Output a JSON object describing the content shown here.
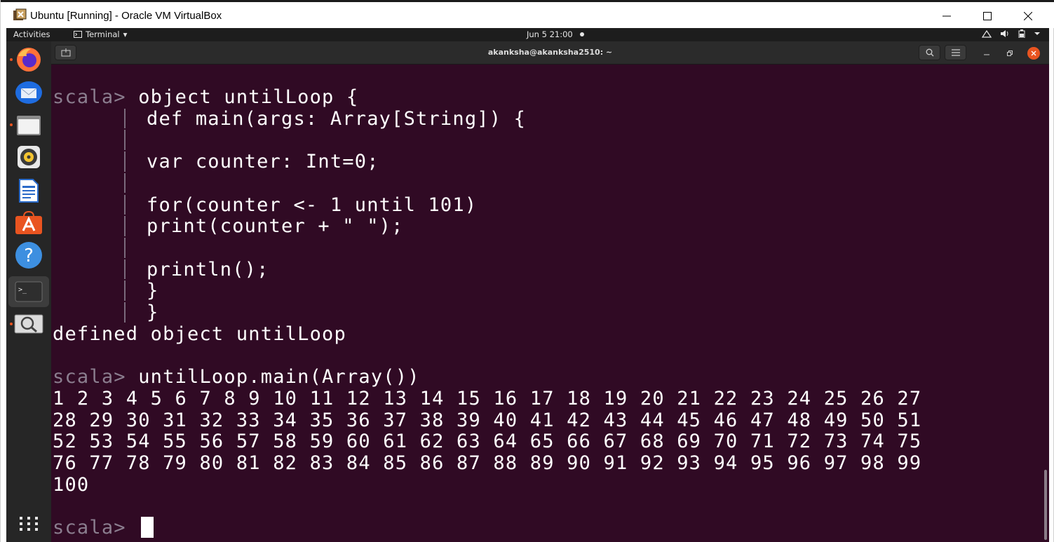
{
  "window": {
    "title": "Ubuntu [Running] - Oracle VM VirtualBox",
    "minimize_glyph": "—",
    "maximize_glyph": "☐",
    "close_glyph": "✕"
  },
  "topbar": {
    "activities": "Activities",
    "app_menu": "Terminal",
    "app_menu_arrow": "▾",
    "clock": "Jun 5  21:00"
  },
  "dock": {
    "items": [
      {
        "icon": "firefox-icon",
        "running": true
      },
      {
        "icon": "thunderbird-icon",
        "running": false
      },
      {
        "icon": "files-icon",
        "running": true
      },
      {
        "icon": "rhythmbox-icon",
        "running": false
      },
      {
        "icon": "libreoffice-writer-icon",
        "running": false
      },
      {
        "icon": "software-center-icon",
        "running": false
      },
      {
        "icon": "help-icon",
        "running": false
      },
      {
        "icon": "terminal-icon",
        "running": false,
        "active": true
      },
      {
        "icon": "screenshot-icon",
        "running": true
      }
    ],
    "help_glyph": "?",
    "terminal_glyph": ">_",
    "apps_grid_icon": "apps-grid-icon"
  },
  "terminal": {
    "title": "akanksha@akanksha2510: ~",
    "prompt": "scala> ",
    "lines": [
      {
        "prompt": true,
        "text": "object untilLoop {"
      },
      {
        "prompt": false,
        "cont": true,
        "text": "def main(args: Array[String]) {"
      },
      {
        "prompt": false,
        "cont": true,
        "text": ""
      },
      {
        "prompt": false,
        "cont": true,
        "text": "var counter: Int=0;"
      },
      {
        "prompt": false,
        "cont": true,
        "text": ""
      },
      {
        "prompt": false,
        "cont": true,
        "text": "for(counter <- 1 until 101)"
      },
      {
        "prompt": false,
        "cont": true,
        "text": "print(counter + \" \");"
      },
      {
        "prompt": false,
        "cont": true,
        "text": ""
      },
      {
        "prompt": false,
        "cont": true,
        "text": "println();"
      },
      {
        "prompt": false,
        "cont": true,
        "text": "}"
      },
      {
        "prompt": false,
        "cont": true,
        "text": "}"
      },
      {
        "prompt": false,
        "text": "defined object untilLoop"
      },
      {
        "prompt": false,
        "text": ""
      },
      {
        "prompt": true,
        "text": "untilLoop.main(Array())"
      },
      {
        "prompt": false,
        "text": "1 2 3 4 5 6 7 8 9 10 11 12 13 14 15 16 17 18 19 20 21 22 23 24 25 26 27"
      },
      {
        "prompt": false,
        "text": "28 29 30 31 32 33 34 35 36 37 38 39 40 41 42 43 44 45 46 47 48 49 50 51"
      },
      {
        "prompt": false,
        "text": "52 53 54 55 56 57 58 59 60 61 62 63 64 65 66 67 68 69 70 71 72 73 74 75"
      },
      {
        "prompt": false,
        "text": "76 77 78 79 80 81 82 83 84 85 86 87 88 89 90 91 92 93 94 95 96 97 98 99"
      },
      {
        "prompt": false,
        "text": "100"
      },
      {
        "prompt": false,
        "text": ""
      },
      {
        "prompt": true,
        "text": "",
        "cursor": true
      }
    ]
  }
}
